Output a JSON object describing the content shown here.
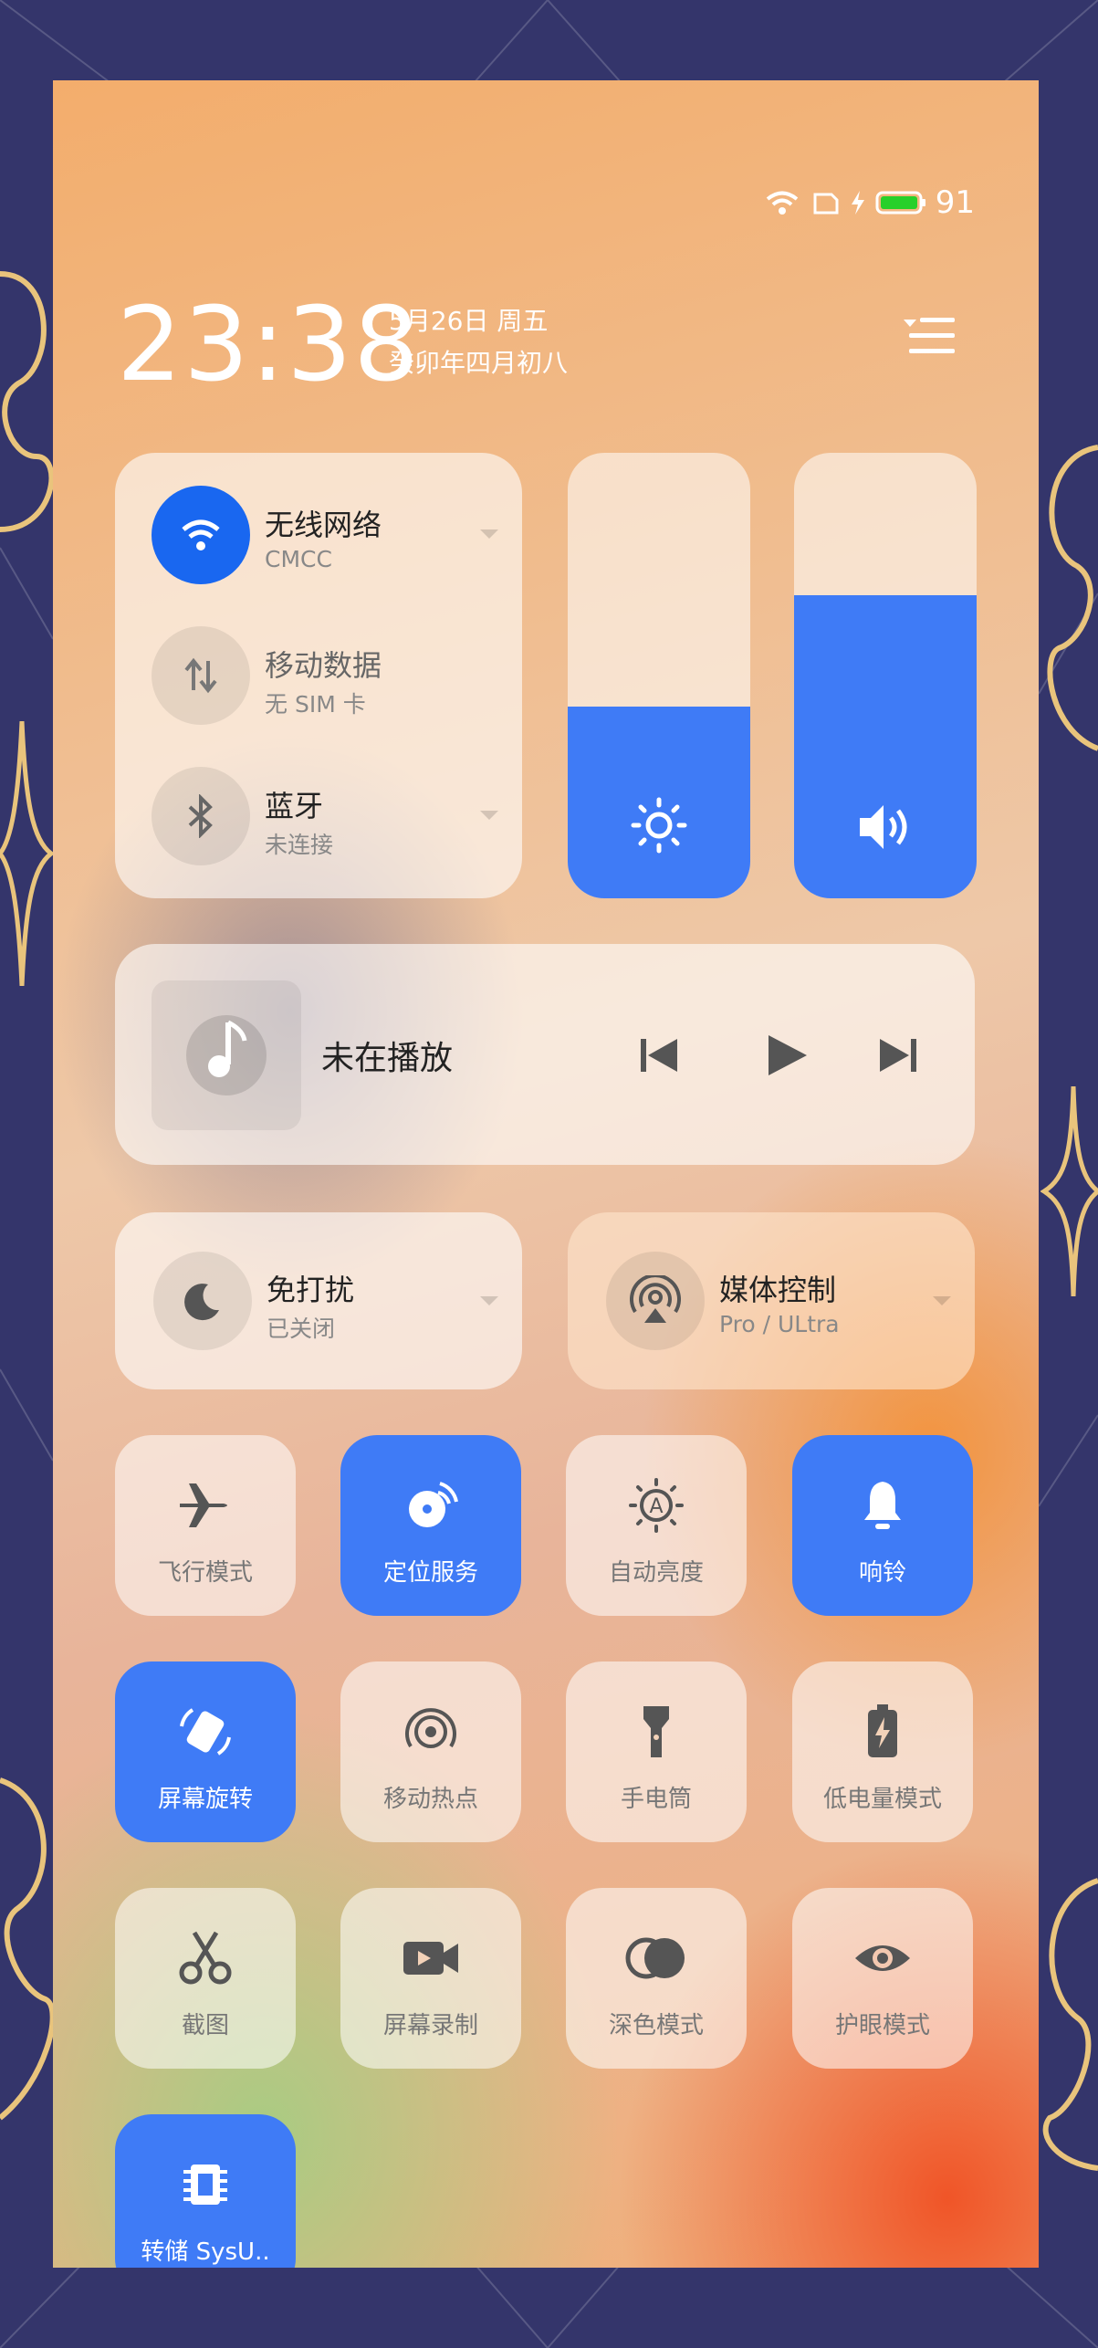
{
  "status_bar": {
    "battery_level": "91",
    "icons": [
      "wifi-icon",
      "sim-icon",
      "charging-icon",
      "battery-icon"
    ]
  },
  "header": {
    "time": "23:38",
    "date": "5月26日 周五",
    "lunar_date": "癸卯年四月初八",
    "edit_icon": "edit-list-icon"
  },
  "connectivity": [
    {
      "title": "无线网络",
      "subtitle": "CMCC",
      "active": true,
      "icon": "wifi-icon"
    },
    {
      "title": "移动数据",
      "subtitle": "无 SIM 卡",
      "active": false,
      "icon": "data-arrows-icon"
    },
    {
      "title": "蓝牙",
      "subtitle": "未连接",
      "active": false,
      "icon": "bluetooth-icon"
    }
  ],
  "sliders": {
    "brightness_level": 0.43,
    "volume_level": 0.68
  },
  "media": {
    "status": "未在播放",
    "icons": [
      "music-note-icon",
      "previous-icon",
      "play-icon",
      "next-icon"
    ]
  },
  "dnd": {
    "title": "免打扰",
    "subtitle": "已关闭"
  },
  "media_control": {
    "title": "媒体控制",
    "subtitle": "Pro / ULtra"
  },
  "tiles": [
    {
      "label": "飞行模式",
      "icon": "airplane-icon",
      "active": false
    },
    {
      "label": "定位服务",
      "icon": "location-icon",
      "active": true
    },
    {
      "label": "自动亮度",
      "icon": "auto-brightness-icon",
      "active": false
    },
    {
      "label": "响铃",
      "icon": "bell-icon",
      "active": true
    },
    {
      "label": "屏幕旋转",
      "icon": "rotate-icon",
      "active": true
    },
    {
      "label": "移动热点",
      "icon": "hotspot-icon",
      "active": false
    },
    {
      "label": "手电筒",
      "icon": "flashlight-icon",
      "active": false
    },
    {
      "label": "低电量模式",
      "icon": "low-battery-icon",
      "active": false
    },
    {
      "label": "截图",
      "icon": "scissors-icon",
      "active": false
    },
    {
      "label": "屏幕录制",
      "icon": "screen-record-icon",
      "active": false
    },
    {
      "label": "深色模式",
      "icon": "dark-mode-icon",
      "active": false
    },
    {
      "label": "护眼模式",
      "icon": "eye-icon",
      "active": false
    },
    {
      "label": "转储 SysU..",
      "icon": "chip-icon",
      "active": true
    }
  ],
  "colors": {
    "accent": "#3f7bf6",
    "wifi_accent": "#1967f0",
    "page_background": "#34356b",
    "battery_green": "#27d02a"
  }
}
